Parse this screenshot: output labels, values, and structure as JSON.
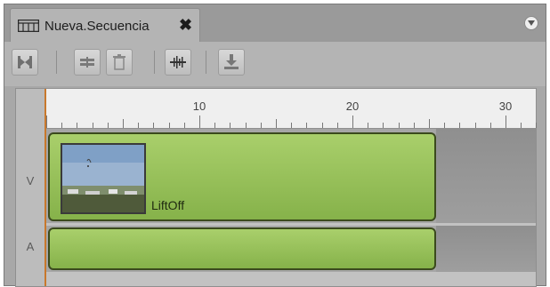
{
  "tab": {
    "title": "Nueva.Secuencia",
    "close_glyph": "✖"
  },
  "icons": {
    "sequence": "sequence-icon",
    "menu": "chevron-down-icon",
    "toolbar": [
      "mark-clip-icon",
      "splice-icon",
      "delete-icon",
      "audio-scrub-icon",
      "download-icon"
    ]
  },
  "ruler": {
    "labels": [
      "10",
      "20",
      "30"
    ]
  },
  "tracks": [
    {
      "label": "V"
    },
    {
      "label": "A"
    }
  ],
  "clip": {
    "name": "LiftOff"
  },
  "colors": {
    "clip_fill": "#9ac25a",
    "clip_border": "#3b4a1d",
    "playhead": "#c8782c",
    "panel": "#b4b4b4"
  }
}
